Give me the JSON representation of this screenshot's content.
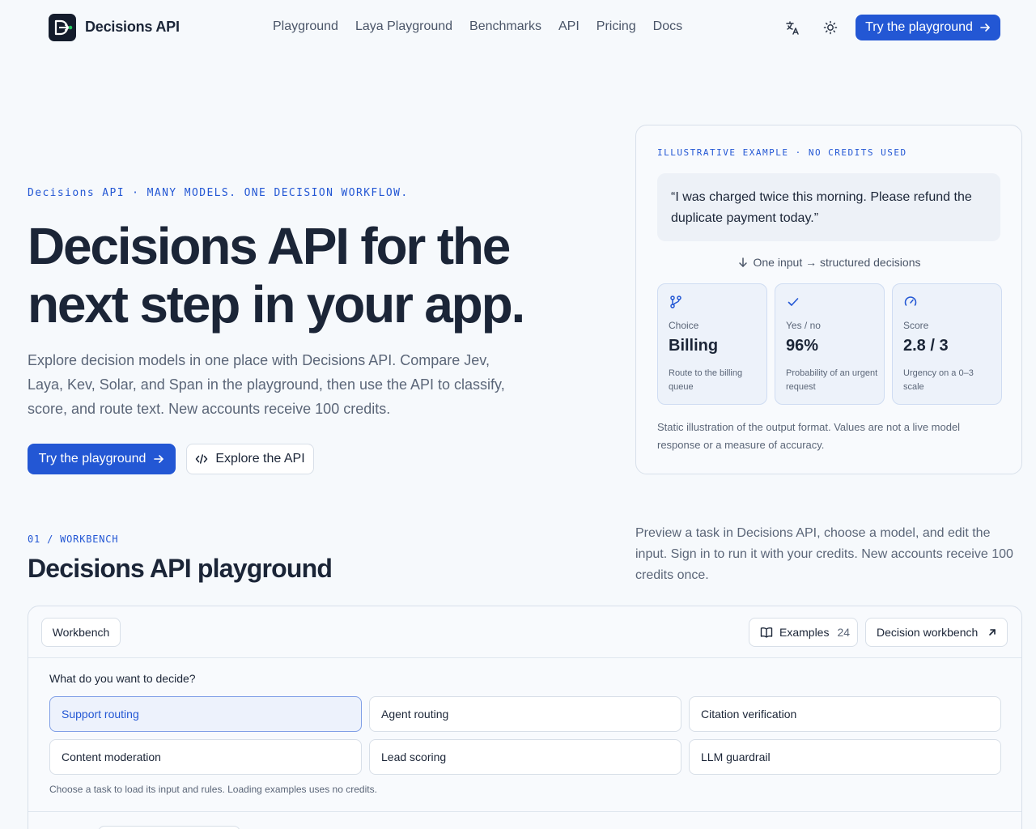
{
  "header": {
    "brand": "Decisions API",
    "nav": [
      "Playground",
      "Laya Playground",
      "Benchmarks",
      "API",
      "Pricing",
      "Docs"
    ],
    "cta_label": "Try the playground"
  },
  "hero": {
    "eyebrow": "Decisions API · MANY MODELS. ONE DECISION WORKFLOW.",
    "title_line1": "Decisions API for the",
    "title_line2": "next step in your app.",
    "lead": "Explore decision models in one place with Decisions API. Compare Jev, Laya, Kev, Solar, and Span in the playground, then use the API to classify, score, and route text. New accounts receive 100 credits.",
    "primary_button": "Try the playground",
    "secondary_button": "Explore the API"
  },
  "example": {
    "eyebrow": "ILLUSTRATIVE EXAMPLE · NO CREDITS USED",
    "quote": "“I was charged twice this morning. Please refund the duplicate payment today.”",
    "flow_label": "One input → structured decisions",
    "tiles": [
      {
        "label": "Choice",
        "value": "Billing",
        "desc": "Route to the billing queue"
      },
      {
        "label": "Yes / no",
        "value": "96%",
        "desc": "Probability of an urgent request"
      },
      {
        "label": "Score",
        "value": "2.8 / 3",
        "desc": "Urgency on a 0–3 scale"
      }
    ],
    "note": "Static illustration of the output format. Values are not a live model response or a measure of accuracy."
  },
  "section": {
    "eyebrow": "01 / WORKBENCH",
    "title": "Decisions API playground",
    "description": "Preview a task in Decisions API, choose a model, and edit the input. Sign in to run it with your credits. New accounts receive 100 credits once."
  },
  "workbench": {
    "tab_label": "Workbench",
    "examples_label": "Examples",
    "examples_count": "24",
    "decision_label": "Decision workbench",
    "question": "What do you want to decide?",
    "options": [
      "Support routing",
      "Agent routing",
      "Citation verification",
      "Content moderation",
      "Lead scoring",
      "LLM guardrail"
    ],
    "selected_option": "Support routing",
    "hint": "Choose a task to load its input and rules. Loading examples uses no credits."
  },
  "colors": {
    "accent": "#2357d4",
    "background": "#f6f9fc",
    "text": "#1b2537",
    "logo_bg": "#141c2c",
    "logo_dot": "#22c55e"
  }
}
